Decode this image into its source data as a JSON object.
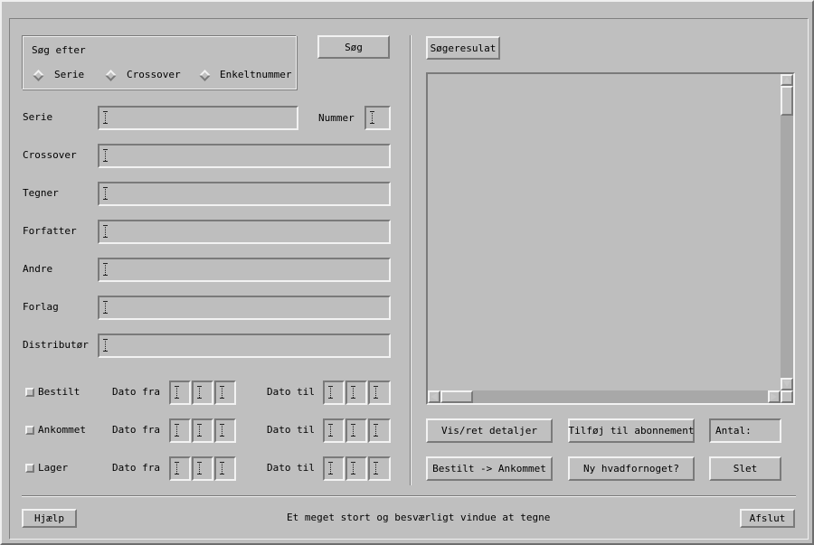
{
  "search_group": {
    "title": "Søg efter",
    "options": [
      "Serie",
      "Crossover",
      "Enkeltnummer"
    ]
  },
  "search_button": "Søg",
  "fields": {
    "serie": "Serie",
    "nummer": "Nummer",
    "crossover": "Crossover",
    "tegner": "Tegner",
    "forfatter": "Forfatter",
    "andre": "Andre",
    "forlag": "Forlag",
    "distributor": "Distributør"
  },
  "status_rows": [
    {
      "label": "Bestilt",
      "from": "Dato fra",
      "to": "Dato til"
    },
    {
      "label": "Ankommet",
      "from": "Dato fra",
      "to": "Dato til"
    },
    {
      "label": "Lager",
      "from": "Dato fra",
      "to": "Dato til"
    }
  ],
  "results": {
    "title": "Søgeresulat"
  },
  "actions": {
    "vis_ret": "Vis/ret detaljer",
    "tilfoej": "Tilføj til abonnement",
    "antal": "Antal:",
    "bestilt_ankommet": "Bestilt -> Ankommet",
    "ny": "Ny hvadfornoget?",
    "slet": "Slet"
  },
  "footer": {
    "help": "Hjælp",
    "message": "Et meget stort og besværligt vindue at tegne",
    "close": "Afslut"
  }
}
